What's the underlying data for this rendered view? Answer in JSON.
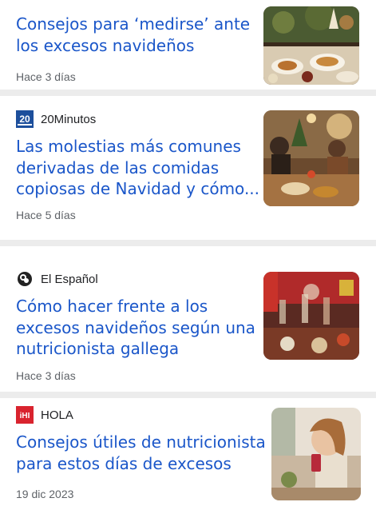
{
  "articles": [
    {
      "source": "",
      "headline_lines": [
        "Consejos para ‘medirse’ ante",
        "los excesos navideños"
      ],
      "date": "Hace 3 días"
    },
    {
      "source": "20Minutos",
      "logo_text": "20",
      "headline_lines": [
        "Las molestias más comunes",
        "derivadas de las comidas",
        "copiosas de Navidad y cómo..."
      ],
      "date": "Hace 5 días"
    },
    {
      "source": "El Español",
      "headline_lines": [
        "Cómo hacer frente a los",
        "excesos navideños según una",
        "nutricionista gallega"
      ],
      "date": "Hace 3 días"
    },
    {
      "source": "HOLA",
      "logo_text": "iHI",
      "headline_lines": [
        "Consejos útiles de nutricionista",
        "para estos días de excesos"
      ],
      "date": "19 dic 2023"
    }
  ],
  "colors": {
    "headline": "#1a56c9",
    "meta": "#5f6368",
    "divider": "#ececec",
    "hola_red": "#d9232e",
    "twenty_blue": "#1d4f9c"
  }
}
